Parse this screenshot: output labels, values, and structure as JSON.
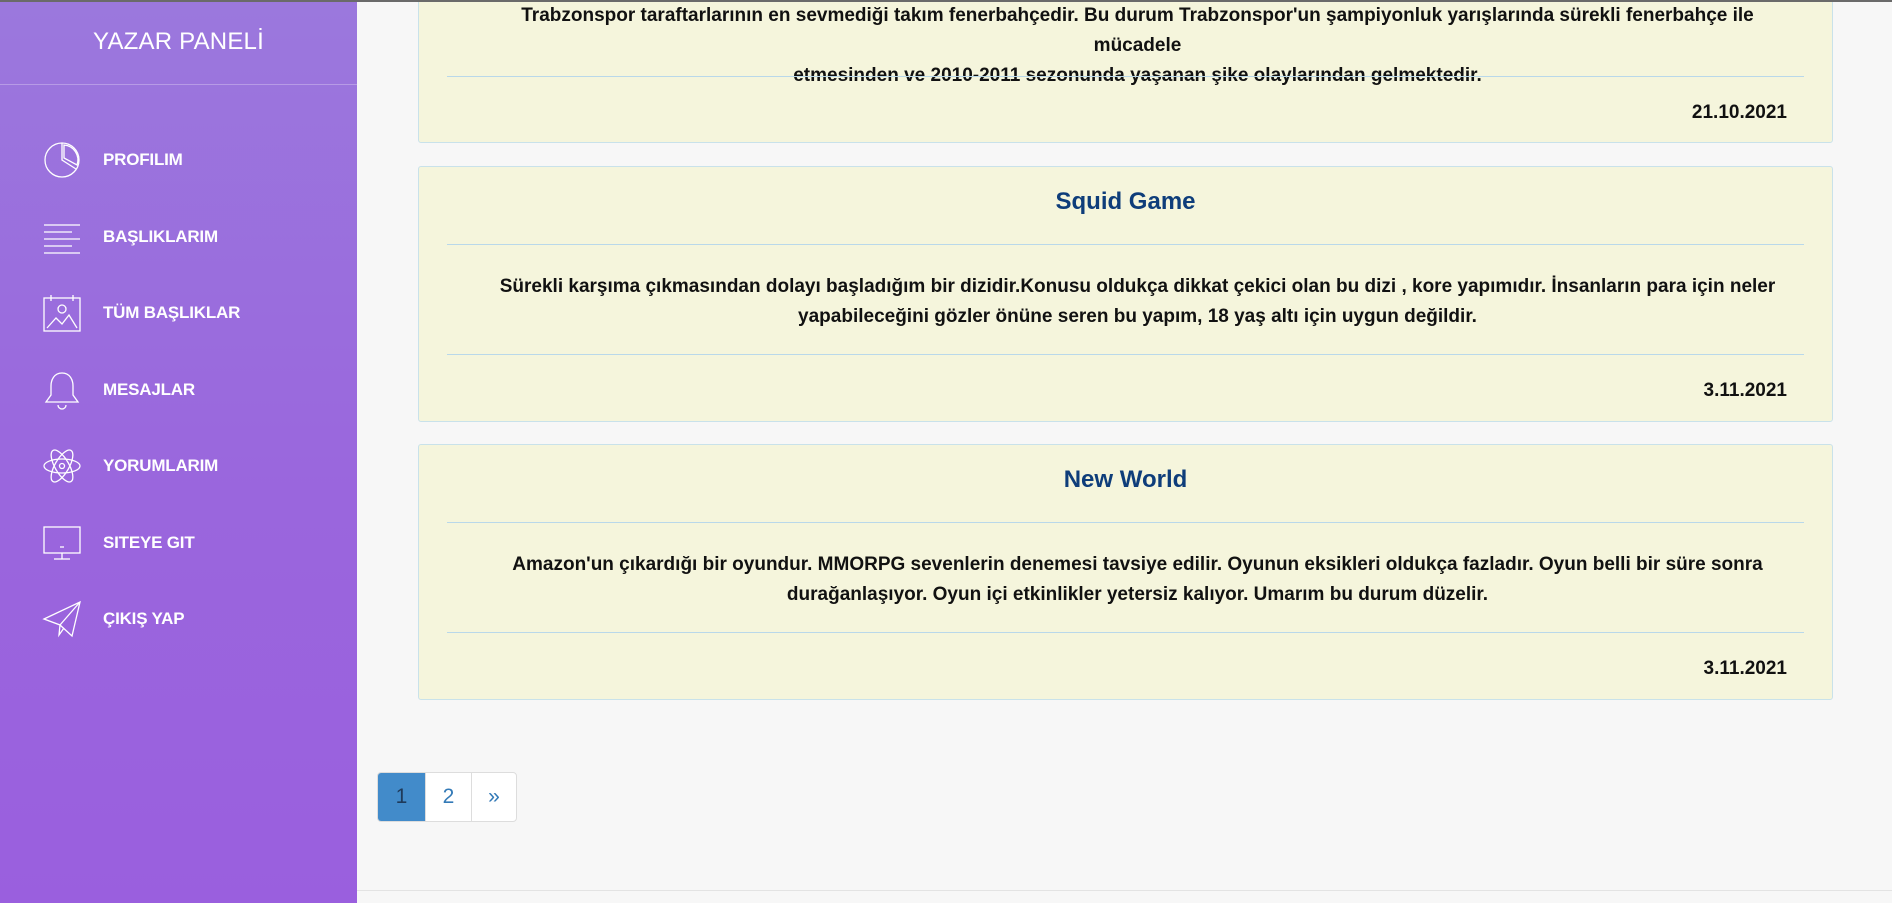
{
  "sidebar": {
    "brand": "YAZAR PANELİ",
    "items": [
      {
        "label": "PROFILIM",
        "icon": "pie-chart-icon"
      },
      {
        "label": "BAŞLIKLARIM",
        "icon": "text-lines-icon"
      },
      {
        "label": "TÜM BAŞLIKLAR",
        "icon": "image-calendar-icon"
      },
      {
        "label": "MESAJLAR",
        "icon": "bell-icon"
      },
      {
        "label": "YORUMLARIM",
        "icon": "atom-icon"
      },
      {
        "label": "SITEYE GIT",
        "icon": "monitor-icon"
      },
      {
        "label": "ÇIKIŞ YAP",
        "icon": "paper-plane-icon"
      }
    ]
  },
  "posts": [
    {
      "title": "",
      "text_line1": "Trabzonspor taraftarlarının en sevmediği takım fenerbahçedir. Bu durum Trabzonspor'un şampiyonluk yarışlarında sürekli fenerbahçe ile mücadele",
      "text_line2": "etmesinden ve 2010-2011 sezonunda yaşanan şike olaylarından gelmektedir.",
      "date": "21.10.2021"
    },
    {
      "title": "Squid Game",
      "text_line1": "Sürekli karşıma çıkmasından dolayı başladığım bir dizidir.Konusu oldukça dikkat çekici olan bu dizi , kore yapımıdır. İnsanların para için neler",
      "text_line2": "yapabileceğini gözler önüne seren bu yapım, 18 yaş altı için uygun değildir.",
      "date": "3.11.2021"
    },
    {
      "title": "New World",
      "text_line1": "Amazon'un çıkardığı bir oyundur. MMORPG sevenlerin denemesi tavsiye edilir. Oyunun eksikleri oldukça fazladır. Oyun belli bir süre sonra",
      "text_line2": "durağanlaşıyor. Oyun içi etkinlikler yetersiz kalıyor. Umarım bu durum düzelir.",
      "date": "3.11.2021"
    }
  ],
  "pagination": {
    "pages": [
      "1",
      "2"
    ],
    "next": "»",
    "active": "1"
  },
  "colors": {
    "sidebar_top": "#9b78dd",
    "sidebar_bottom": "#9a5fde",
    "card_bg": "#f5f5dc",
    "title": "#0e3d7a",
    "pagination_active": "#428bca"
  }
}
